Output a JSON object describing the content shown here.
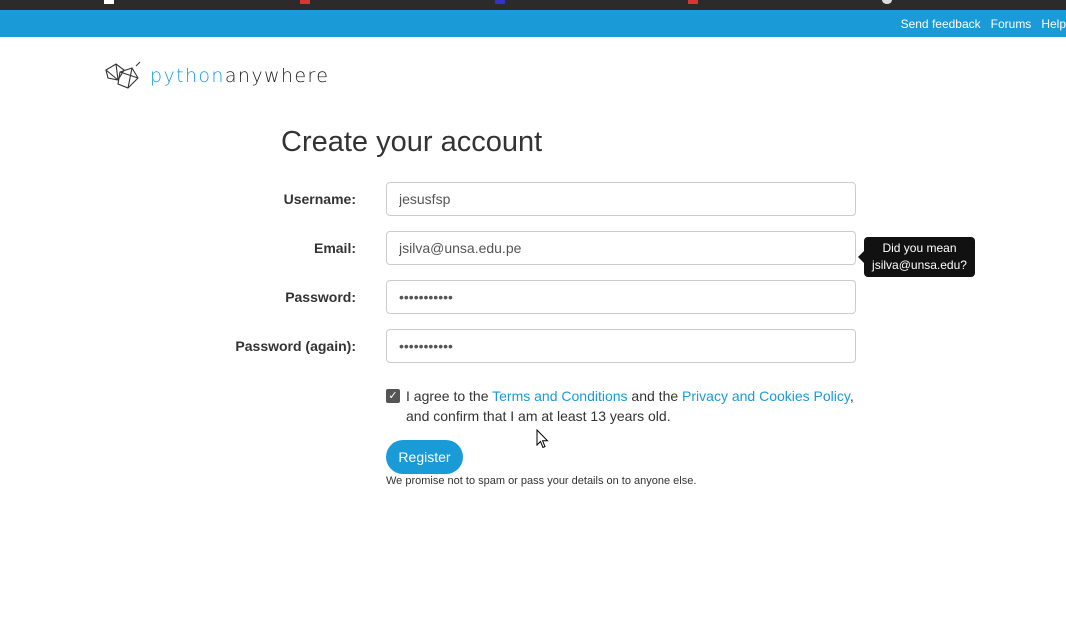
{
  "topbar": {
    "links": [
      "Send feedback",
      "Forums",
      "Help"
    ],
    "color": "#1a9bd7"
  },
  "logo": {
    "part1": "python",
    "part2": "anywhere",
    "icon": "pythonanywhere-logo-icon"
  },
  "form": {
    "title": "Create your account",
    "username_label": "Username:",
    "username_value": "jesusfsp",
    "email_label": "Email:",
    "email_value": "jsilva@unsa.edu.pe",
    "password_label": "Password:",
    "password_value": "•••••••••••",
    "password2_label": "Password (again):",
    "password2_value": "•••••••••••"
  },
  "tooltip": {
    "line1": "Did you mean",
    "line2": "jsilva@unsa.edu?"
  },
  "agree": {
    "checked": true,
    "prefix": "I agree to the ",
    "terms_link": "Terms and Conditions",
    "middle": " and the ",
    "privacy_link": "Privacy and Cookies Policy",
    "suffix": ", and confirm that I am at least 13 years old."
  },
  "register": {
    "label": "Register",
    "promise": "We promise not to spam or pass your details on to anyone else."
  }
}
